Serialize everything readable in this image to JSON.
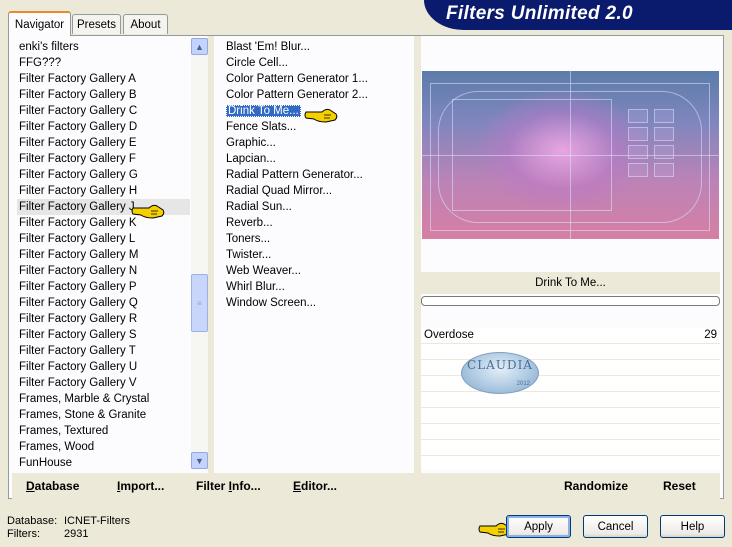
{
  "window": {
    "title": "Filters Unlimited 2.0"
  },
  "tabs": [
    {
      "label": "Navigator",
      "active": true
    },
    {
      "label": "Presets",
      "active": false
    },
    {
      "label": "About",
      "active": false
    }
  ],
  "categories": {
    "items": [
      "enki's filters",
      "FFG???",
      "Filter Factory Gallery A",
      "Filter Factory Gallery B",
      "Filter Factory Gallery C",
      "Filter Factory Gallery D",
      "Filter Factory Gallery E",
      "Filter Factory Gallery F",
      "Filter Factory Gallery G",
      "Filter Factory Gallery H",
      "Filter Factory Gallery J",
      "Filter Factory Gallery K",
      "Filter Factory Gallery L",
      "Filter Factory Gallery M",
      "Filter Factory Gallery N",
      "Filter Factory Gallery P",
      "Filter Factory Gallery Q",
      "Filter Factory Gallery R",
      "Filter Factory Gallery S",
      "Filter Factory Gallery T",
      "Filter Factory Gallery U",
      "Filter Factory Gallery V",
      "Frames, Marble & Crystal",
      "Frames, Stone & Granite",
      "Frames, Textured",
      "Frames, Wood",
      "FunHouse"
    ],
    "selected": "Filter Factory Gallery J"
  },
  "filters": {
    "items": [
      "Blast 'Em! Blur...",
      "Circle Cell...",
      "Color Pattern Generator 1...",
      "Color Pattern Generator 2...",
      "Drink To Me...",
      "Fence Slats...",
      "Graphic...",
      "Lapcian...",
      "Radial Pattern Generator...",
      "Radial Quad Mirror...",
      "Radial Sun...",
      "Reverb...",
      "Toners...",
      "Twister...",
      "Web Weaver...",
      "Whirl Blur...",
      "Window Screen..."
    ],
    "selected": "Drink To Me..."
  },
  "preview": {
    "filter_name": "Drink To Me...",
    "progress_percent": 0
  },
  "params": [
    {
      "name": "Overdose",
      "value": "29"
    }
  ],
  "watermark": {
    "text": "CLAUDIA",
    "year": "2012"
  },
  "linkbar": {
    "database": {
      "first": "D",
      "rest": "atabase"
    },
    "import": {
      "first": "I",
      "rest": "mport..."
    },
    "filter_info": {
      "pre": "Filter ",
      "first": "I",
      "rest": "nfo..."
    },
    "editor": {
      "first": "E",
      "rest": "ditor..."
    },
    "randomize": "Randomize",
    "reset": "Reset"
  },
  "info": {
    "database_label": "Database:",
    "database_value": "ICNET-Filters",
    "filters_label": "Filters:",
    "filters_value": "2931"
  },
  "buttons": {
    "apply": "Apply",
    "cancel": "Cancel",
    "help": "Help"
  },
  "colors": {
    "banner": "#0a1b6e",
    "selection": "#316ac5",
    "hand": "#f5d000"
  },
  "icons": {
    "scroll_up": "chevron-up-icon",
    "scroll_down": "chevron-down-icon",
    "pointer": "pointing-hand-icon"
  }
}
